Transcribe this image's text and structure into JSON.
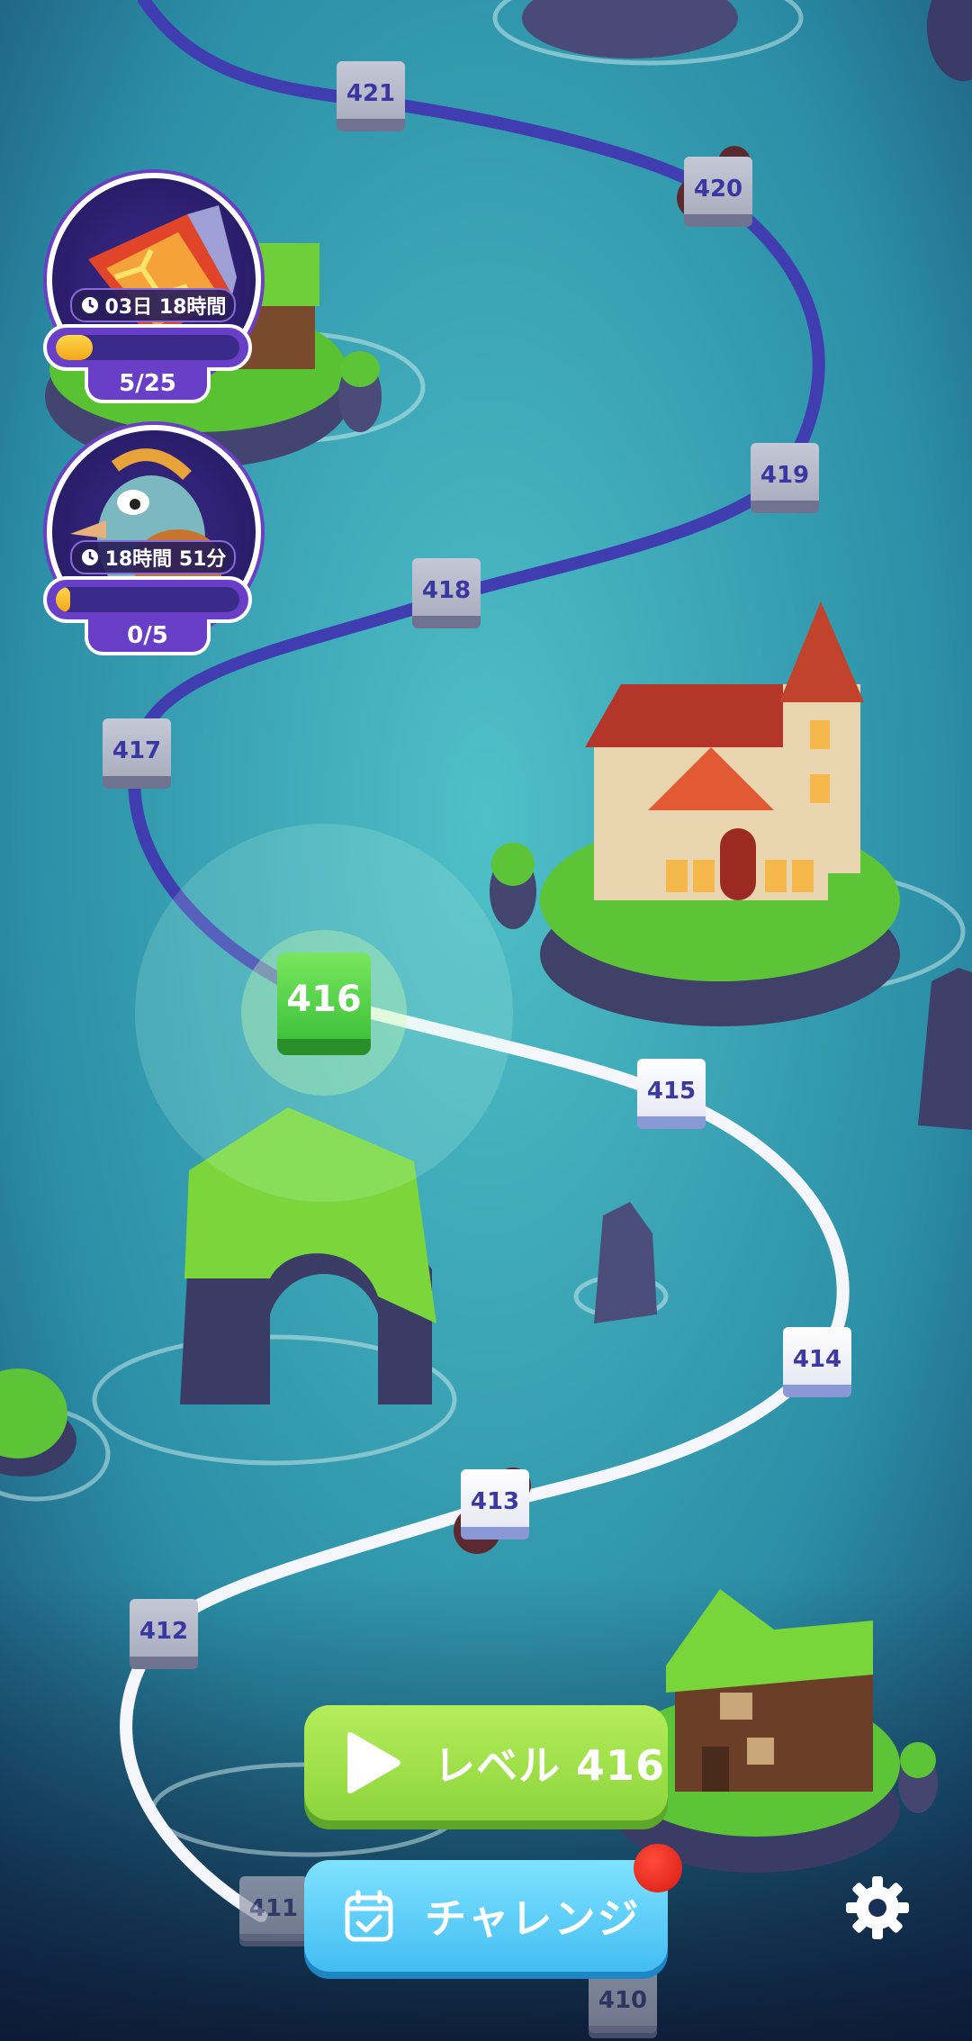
{
  "map": {
    "current_level": "416",
    "levels": [
      "410",
      "411",
      "412",
      "413",
      "414",
      "415",
      "417",
      "418",
      "419",
      "420",
      "421"
    ]
  },
  "events": [
    {
      "icon": "lava-crystal-icon",
      "timer": "03日 18時間",
      "count": "5/25",
      "progress": 0.2
    },
    {
      "icon": "bird-character-icon",
      "timer": "18時間 51分",
      "count": "0/5",
      "progress": 0.05
    }
  ],
  "buttons": {
    "play_label": "レベル 416",
    "challenge_label": "チャレンジ"
  },
  "colors": {
    "water": "#2f9bb0",
    "path_done": "#ffffff",
    "path_locked": "#4a48b0",
    "current_level": "#5bd24a",
    "play_button": "#9be04a",
    "challenge_button": "#55c8f5",
    "notification": "#e0251b"
  }
}
